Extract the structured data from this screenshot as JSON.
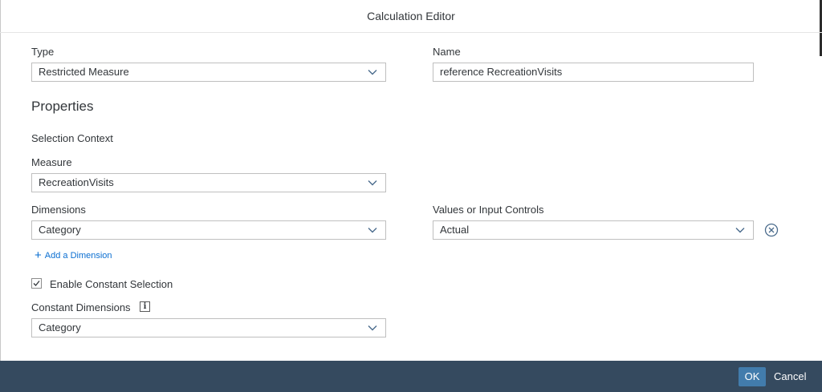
{
  "dialog": {
    "title": "Calculation Editor"
  },
  "type": {
    "label": "Type",
    "value": "Restricted Measure"
  },
  "name": {
    "label": "Name",
    "value": "reference RecreationVisits"
  },
  "properties": {
    "title": "Properties",
    "selection_context": "Selection Context"
  },
  "measure": {
    "label": "Measure",
    "value": "RecreationVisits"
  },
  "dimensions": {
    "label": "Dimensions",
    "value": "Category"
  },
  "values_controls": {
    "label": "Values or Input Controls",
    "value": "Actual"
  },
  "add_dimension": {
    "label": "Add a Dimension"
  },
  "constant_selection": {
    "label": "Enable Constant Selection",
    "checked": true
  },
  "constant_dimensions": {
    "label": "Constant Dimensions",
    "value": "Category"
  },
  "footer": {
    "ok_label": "OK",
    "cancel_label": "Cancel"
  },
  "colors": {
    "footer_bg": "#354a5f",
    "ok_bg": "#427cac",
    "link": "#0a6ed1"
  }
}
